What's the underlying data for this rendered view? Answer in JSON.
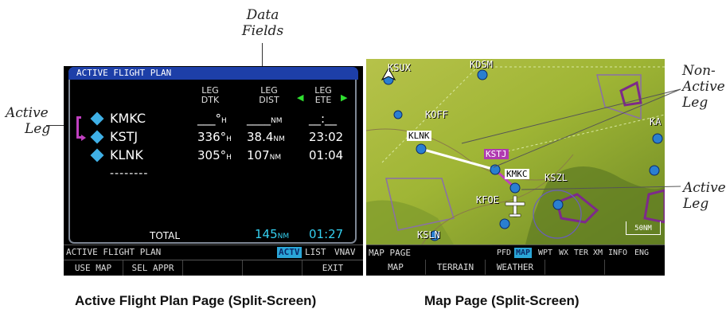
{
  "callouts": {
    "data_fields": [
      "Data",
      "Fields"
    ],
    "active_leg_left": [
      "Active",
      "Leg"
    ],
    "non_active_leg": [
      "Non-",
      "Active",
      "Leg"
    ],
    "active_leg_right": [
      "Active",
      "Leg"
    ]
  },
  "captions": {
    "left": "Active Flight Plan Page (Split-Screen)",
    "right": "Map Page (Split-Screen)"
  },
  "fpl": {
    "title": "ACTIVE FLIGHT PLAN",
    "columns": [
      {
        "line1": "LEG",
        "line2": "DTK"
      },
      {
        "line1": "LEG",
        "line2": "DIST"
      },
      {
        "line1": "LEG",
        "line2": "ETE"
      }
    ],
    "col_prev_arrow": "◀",
    "col_next_arrow": "▶",
    "waypoints": [
      {
        "name": "KMKC",
        "dtk": "___°",
        "dtk_unit": "H",
        "dist": "____",
        "dist_unit": "NM",
        "ete": "__:__"
      },
      {
        "name": "KSTJ",
        "dtk": "336°",
        "dtk_unit": "H",
        "dist": "38.4",
        "dist_unit": "NM",
        "ete": "23:02"
      },
      {
        "name": "KLNK",
        "dtk": "305°",
        "dtk_unit": "H",
        "dist": "107",
        "dist_unit": "NM",
        "ete": "01:04"
      }
    ],
    "empty_row": "--------",
    "total_label": "TOTAL",
    "total_dist": "145",
    "total_dist_unit": "NM",
    "total_ete": "01:27",
    "status_bar": {
      "page_name": "ACTIVE FLIGHT PLAN",
      "tabs": [
        "ACTV",
        "LIST",
        "VNAV"
      ],
      "active_tab": "ACTV"
    },
    "softkeys": [
      "USE MAP",
      "SEL APPR",
      "",
      "",
      "EXIT"
    ]
  },
  "map": {
    "labels": {
      "ksux": "KSUX",
      "kdsm": "KDSM",
      "koff": "KOFF",
      "klnk": "KLNK",
      "kstj": "KSTJ",
      "kmkc": "KMKC",
      "kszl": "KSZL",
      "kfoe": "KFOE",
      "ksln": "KSLN",
      "ka": "KA"
    },
    "range_label": "50NM",
    "status_bar": {
      "page_name": "MAP PAGE",
      "tabs": [
        "PFD",
        "MAP",
        "WPT",
        "WX",
        "TER",
        "XM",
        "INFO",
        "ENG"
      ],
      "active_tab": "MAP"
    },
    "softkeys": [
      "MAP",
      "TERRAIN",
      "WEATHER",
      "",
      ""
    ]
  },
  "colors": {
    "title_bar": "#1d3fa8",
    "cyan": "#34d0f0",
    "active_leg": "#c040c0",
    "map_terrain": "#9fb535"
  }
}
